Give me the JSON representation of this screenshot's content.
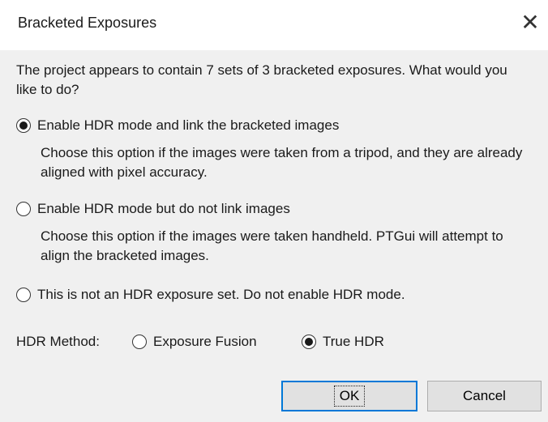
{
  "window": {
    "title": "Bracketed Exposures",
    "close_glyph": "✕"
  },
  "message": "The project appears to contain 7 sets of 3 bracketed exposures. What would you like to do?",
  "options": [
    {
      "label": "Enable HDR mode and link the bracketed images",
      "description": "Choose this option if the images were taken from a tripod, and they are already aligned with pixel accuracy.",
      "selected": true
    },
    {
      "label": "Enable HDR mode but do not link images",
      "description": "Choose this option if the images were taken handheld. PTGui will attempt to align the bracketed images.",
      "selected": false
    },
    {
      "label": "This is not an HDR exposure set. Do not enable HDR mode.",
      "description": "",
      "selected": false
    }
  ],
  "hdr_method": {
    "label": "HDR Method:",
    "options": [
      {
        "label": "Exposure Fusion",
        "selected": false
      },
      {
        "label": "True HDR",
        "selected": true
      }
    ]
  },
  "buttons": {
    "ok": "OK",
    "cancel": "Cancel"
  },
  "colors": {
    "background": "#f0f0f0",
    "titlebar": "#ffffff",
    "button_face": "#e1e1e1",
    "default_button_border": "#0078d7"
  }
}
